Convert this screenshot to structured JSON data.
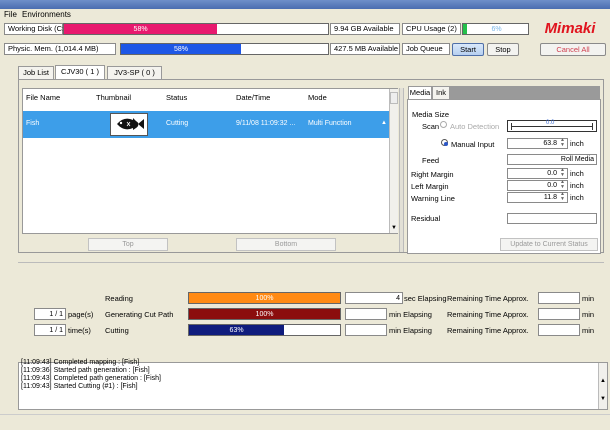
{
  "menu": {
    "file": "File",
    "environments": "Environments"
  },
  "status": {
    "working_disk_label": "Working Disk (C:)",
    "working_disk_pct_text": "58%",
    "working_disk_pct": 58,
    "working_disk_avail": "9.94 GB Available",
    "cpu_label": "CPU Usage (2)",
    "cpu_pct_text": "6%",
    "cpu_pct": 6,
    "phys_mem_label": "Physic. Mem. (1,014.4 MB)",
    "phys_mem_pct_text": "58%",
    "phys_mem_pct": 58,
    "phys_mem_avail": "427.5 MB Available",
    "job_queue_label": "Job Queue",
    "start": "Start",
    "stop": "Stop",
    "cancel_all": "Cancel All",
    "logo": "Mimaki"
  },
  "tabs": [
    "Job List",
    "CJV30 ( 1 )",
    "JV3-SP ( 0 )"
  ],
  "table": {
    "headers": [
      "File Name",
      "Thumbnail",
      "Status",
      "Date/Time",
      "Mode"
    ],
    "row": {
      "file": "Fish",
      "status": "Cutting",
      "datetime": "9/11/08 11:09:32 ...",
      "mode": "Multi Function"
    }
  },
  "queue_buttons": {
    "top": "Top",
    "bottom": "Bottom"
  },
  "right_tabs": [
    "Media",
    "Ink"
  ],
  "media": {
    "size_label": "Media Size",
    "scan_label": "Scan",
    "auto_detect": "Auto Detection",
    "manual_input": "Manual Input",
    "manual_value": "63.8",
    "unit": "inch",
    "feed_label": "Feed",
    "feed_value": "Roll Media",
    "right_margin_label": "Right Margin",
    "right_margin_value": "0.0",
    "left_margin_label": "Left Margin",
    "left_margin_value": "0.0",
    "warning_label": "Warning Line",
    "warning_value": "11.8",
    "residual_label": "Residual",
    "residual_value": "",
    "update_btn": "Update to Current Status",
    "scale_text": "0.0"
  },
  "progress": {
    "reading_label": "Reading",
    "reading_text": "100%",
    "reading_pct": 100,
    "reading_elapsed": "4",
    "gen_label": "Generating Cut Path",
    "gen_text": "100%",
    "gen_pct": 100,
    "gen_elapsed": "",
    "cut_label": "Cutting",
    "cut_text": "63%",
    "cut_pct": 63,
    "cut_elapsed": "",
    "sec_elapsing": "sec Elapsing",
    "min_elapsing": "min Elapsing",
    "remaining": "Remaining Time Approx.",
    "min": "min",
    "page_value": "1 / 1",
    "page_label": "page(s)",
    "time_value": "1 / 1",
    "time_label": "time(s)"
  },
  "log": [
    "[11:09:43] Completed mapping : [Fish]",
    "[11:09:36] Started path generation : [Fish]",
    "[11:09:43] Completed path generation : [Fish]",
    "[11:09:43] Started Cutting (#1) : [Fish]"
  ]
}
